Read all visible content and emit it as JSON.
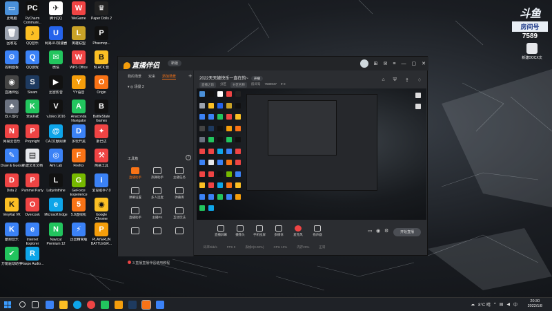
{
  "desktop": {
    "icons": [
      {
        "label": "此电脑",
        "color": "#4a90d9",
        "glyph": "▭"
      },
      {
        "label": "PyCharm Communi...",
        "color": "#111",
        "glyph": "PC"
      },
      {
        "label": "腾讯QQ",
        "color": "#ffffff",
        "glyph": "✈"
      },
      {
        "label": "WeGame",
        "color": "#ef4444",
        "glyph": "W"
      },
      {
        "label": "Paper Dolls 2",
        "color": "#222",
        "glyph": "♛"
      },
      {
        "label": "回收站",
        "color": "#9ca3af",
        "glyph": "🗑"
      },
      {
        "label": "QQ音乐",
        "color": "#fbbf24",
        "glyph": "♪"
      },
      {
        "label": "网易UU加速器",
        "color": "#2563eb",
        "glyph": "U"
      },
      {
        "label": "英雄联盟",
        "color": "#c9a227",
        "glyph": "L"
      },
      {
        "label": "Phasmop...",
        "color": "#111",
        "glyph": "P"
      },
      {
        "label": "控制面板",
        "color": "#3b82f6",
        "glyph": "⚙"
      },
      {
        "label": "QQ游戏",
        "color": "#3b82f6",
        "glyph": "Q"
      },
      {
        "label": "微信",
        "color": "#22c55e",
        "glyph": "✉"
      },
      {
        "label": "WPS Office",
        "color": "#ef4444",
        "glyph": "W"
      },
      {
        "label": "BLACK:影",
        "color": "#fbbf24",
        "glyph": "B"
      },
      {
        "label": "直播伴侣",
        "color": "#444",
        "glyph": "◉"
      },
      {
        "label": "Steam",
        "color": "#1e3a5f",
        "glyph": "S"
      },
      {
        "label": "迅雷影音",
        "color": "#111",
        "glyph": "▶"
      },
      {
        "label": "YY语音",
        "color": "#f59e0b",
        "glyph": "Y"
      },
      {
        "label": "Origin",
        "color": "#f97316",
        "glyph": "O"
      },
      {
        "label": "双人成行",
        "color": "#6b7280",
        "glyph": "♣"
      },
      {
        "label": "全民K歌",
        "color": "#22c55e",
        "glyph": "K"
      },
      {
        "label": "vJoleo 2016",
        "color": "#111",
        "glyph": "V"
      },
      {
        "label": "Anaconda Navigator",
        "color": "#22c55e",
        "glyph": "A"
      },
      {
        "label": "BattleState Games",
        "color": "#111",
        "glyph": "B"
      },
      {
        "label": "网易云音乐",
        "color": "#ef4444",
        "glyph": "N"
      },
      {
        "label": "Propnight",
        "color": "#ef4444",
        "glyph": "P"
      },
      {
        "label": "CAJ文献阅读",
        "color": "#0ea5e9",
        "glyph": "@"
      },
      {
        "label": "多玩开黑",
        "color": "#3b82f6",
        "glyph": "D"
      },
      {
        "label": "斯巴达",
        "color": "#ef4444",
        "glyph": "✦"
      },
      {
        "label": "Draw & Guess",
        "color": "#3b82f6",
        "glyph": "✎"
      },
      {
        "label": "新建文本文档",
        "color": "#e5e7eb",
        "glyph": "▤"
      },
      {
        "label": "Aim Lab",
        "color": "#3b82f6",
        "glyph": "◎"
      },
      {
        "label": "Firefox",
        "color": "#f97316",
        "glyph": "F"
      },
      {
        "label": "简易工具",
        "color": "#ef4444",
        "glyph": "⚒"
      },
      {
        "label": "Dota 2",
        "color": "#ef4444",
        "glyph": "D"
      },
      {
        "label": "Pummel Party",
        "color": "#ef4444",
        "glyph": "P"
      },
      {
        "label": "Labyrinthine",
        "color": "#111",
        "glyph": "L"
      },
      {
        "label": "GeForce Experience",
        "color": "#76b900",
        "glyph": "G"
      },
      {
        "label": "爱思助手7.0",
        "color": "#3b82f6",
        "glyph": "i"
      },
      {
        "label": "VeryKat VK",
        "color": "#fbbf24",
        "glyph": "K"
      },
      {
        "label": "Overcook",
        "color": "#ef4444",
        "glyph": "O"
      },
      {
        "label": "Microsoft Edge",
        "color": "#0ea5e9",
        "glyph": "e"
      },
      {
        "label": "5.8虚拟机",
        "color": "#f97316",
        "glyph": "5"
      },
      {
        "label": "Google Chrome",
        "color": "#fbbf24",
        "glyph": "◉"
      },
      {
        "label": "酷狗音乐",
        "color": "#3b82f6",
        "glyph": "K"
      },
      {
        "label": "Internet Explorer",
        "color": "#3b82f6",
        "glyph": "e"
      },
      {
        "label": "Navicat Premium 12",
        "color": "#22c55e",
        "glyph": "N"
      },
      {
        "label": "迅雷精简版",
        "color": "#3b82f6",
        "glyph": "⚡"
      },
      {
        "label": "PLAYERUN BATTLEGR...",
        "color": "#f59e0b",
        "glyph": "P"
      },
      {
        "label": "万能驱动助手",
        "color": "#22c55e",
        "glyph": "✔"
      },
      {
        "label": "Raspo Audio...",
        "color": "#0ea5e9",
        "glyph": "R"
      }
    ]
  },
  "watermark": {
    "logo": "斗鱼",
    "name": "房间号",
    "number": "7589"
  },
  "side_icon": {
    "label": "新建DOCX文"
  },
  "app": {
    "logo": "直播伴侣",
    "badge": "新版",
    "nav": [
      "我的场景",
      "双来",
      "添加场景"
    ],
    "scene": "场景 2",
    "title": "2022天天被快乐一直在的~",
    "title_tag": "开播",
    "sub": [
      "直播之前",
      "分区",
      "分区名称",
      "房间号",
      "7589037",
      "♥ 0"
    ],
    "tools_header": "工具箱",
    "tools": [
      {
        "label": "直播助手",
        "hl": true
      },
      {
        "label": "热舞助手",
        "hl": false
      },
      {
        "label": "主播任务",
        "hl": false
      },
      {
        "label": "弹幕设置",
        "hl": false
      },
      {
        "label": "多人连麦",
        "hl": false
      },
      {
        "label": "弹幕库",
        "hl": false
      },
      {
        "label": "直播助手",
        "hl": false
      },
      {
        "label": "主播PK",
        "hl": false
      },
      {
        "label": "互动玩法",
        "hl": false
      },
      {
        "label": "",
        "hl": false
      },
      {
        "label": "",
        "hl": false
      },
      {
        "label": "",
        "hl": false
      }
    ],
    "footer_tip": "3.直播直播伴侣使用教程",
    "bottom_tools": [
      {
        "label": "直播屏幕",
        "red": false
      },
      {
        "label": "摄像头",
        "red": false
      },
      {
        "label": "手机投屏",
        "red": false
      },
      {
        "label": "多媒体",
        "red": false
      },
      {
        "label": "麦克风",
        "red": true
      },
      {
        "label": "扬声器",
        "red": false
      }
    ],
    "go_live": "开始直播",
    "stats": [
      "码率0kb/s",
      "FPS 0",
      "丢帧0(0.00%)",
      "CPU 10%",
      "内存20%",
      "正常"
    ]
  },
  "taskbar": {
    "weather": "8°C 晴",
    "lang": "中",
    "time": "20:30",
    "date": "2022/1/8"
  }
}
